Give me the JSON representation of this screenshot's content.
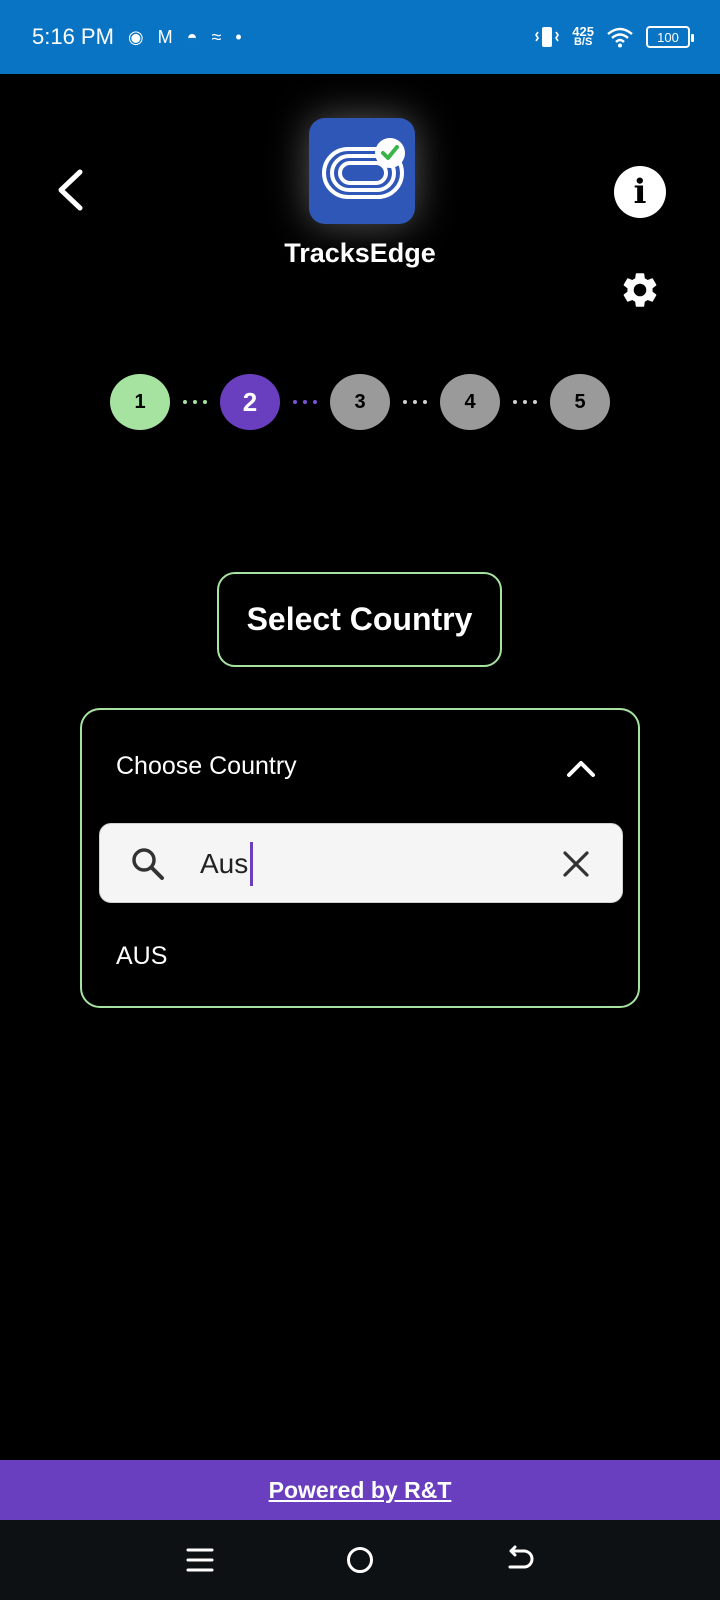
{
  "status_bar": {
    "time": "5:16 PM",
    "net_speed_value": "425",
    "net_speed_unit": "B/S",
    "battery": "100"
  },
  "header": {
    "app_name": "TracksEdge",
    "info_label": "i"
  },
  "stepper": {
    "steps": [
      "1",
      "2",
      "3",
      "4",
      "5"
    ],
    "current_step": 2
  },
  "page_title": "Select Country",
  "dropdown": {
    "label": "Choose Country",
    "search_value": "Aus",
    "results": [
      "AUS"
    ]
  },
  "footer": {
    "text": "Powered by R&T"
  },
  "colors": {
    "status_bar": "#0a74c4",
    "accent_green": "#a6e3a1",
    "accent_purple": "#6a3fbf",
    "inactive_step": "#9a9a9a"
  }
}
